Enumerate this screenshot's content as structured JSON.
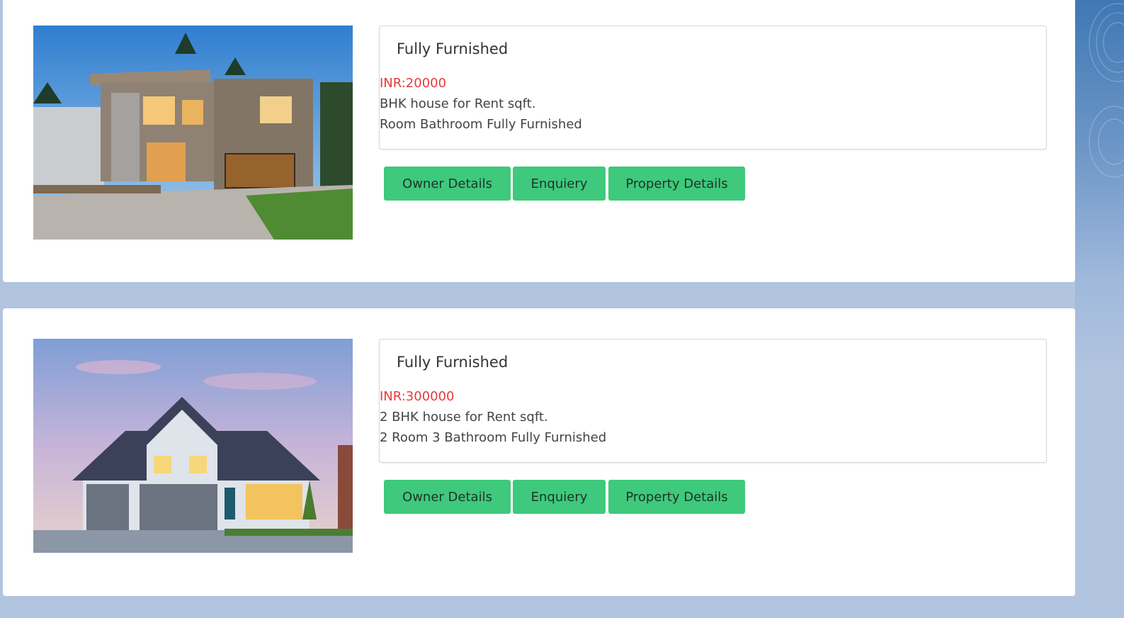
{
  "listings": [
    {
      "title": "Fully Furnished",
      "price": "INR:20000",
      "description": "BHK house for Rent sqft.",
      "rooms": "Room Bathroom Fully Furnished",
      "buttons": {
        "owner": "Owner Details",
        "enquiry": "Enquiery",
        "property": "Property Details"
      },
      "image": "modern-house-photo"
    },
    {
      "title": "Fully Furnished",
      "price": "INR:300000",
      "description": "2 BHK house for Rent sqft.",
      "rooms": "2 Room 3 Bathroom Fully Furnished",
      "buttons": {
        "owner": "Owner Details",
        "enquiry": "Enquiery",
        "property": "Property Details"
      },
      "image": "suburban-house-photo"
    }
  ],
  "colors": {
    "background": "#b1c4e0",
    "price": "#e83a3a",
    "button": "#3ec97c"
  }
}
